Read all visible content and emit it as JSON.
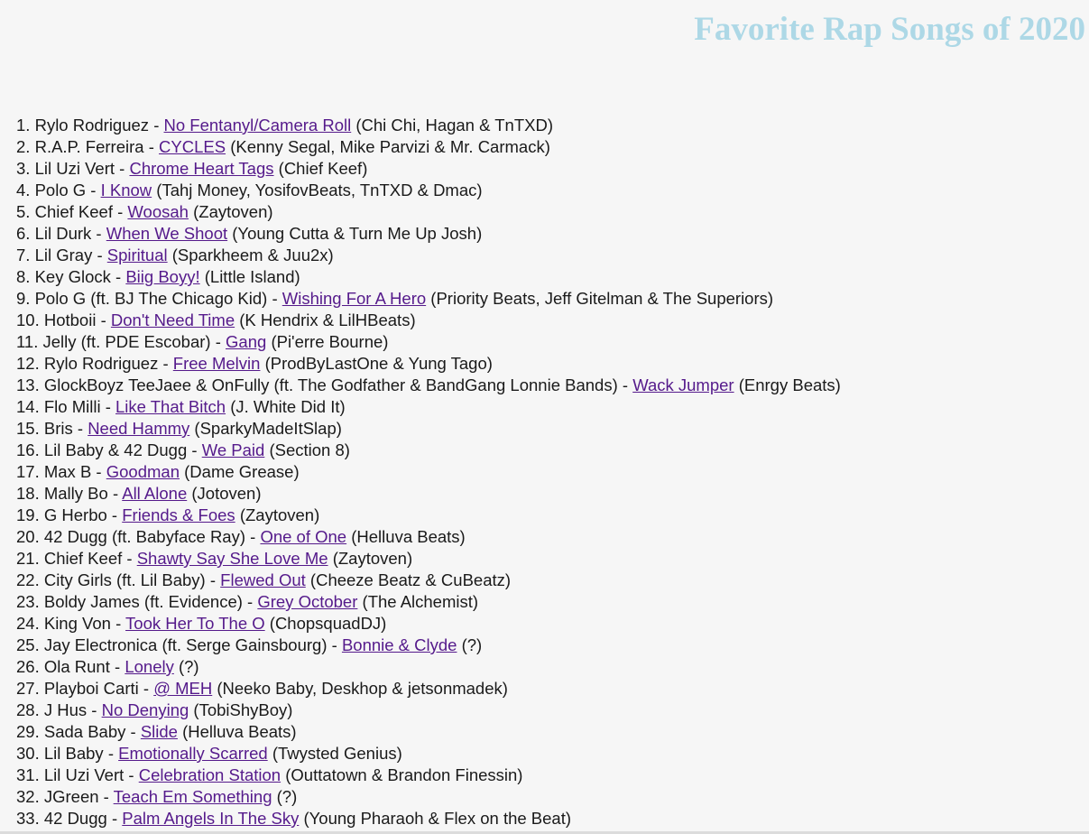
{
  "title": "Favorite Rap Songs of 2020",
  "colors": {
    "title": "#add8e6",
    "link_visited": "#551a8b",
    "text": "#1a1a1a",
    "background": "#f6f6f6"
  },
  "songs": [
    {
      "number": "1.",
      "artist": "Rylo Rodriguez",
      "title": "No Fentanyl/Camera Roll",
      "producers": "(Chi Chi, Hagan & TnTXD)"
    },
    {
      "number": "2.",
      "artist": "R.A.P. Ferreira",
      "title": "CYCLES",
      "producers": "(Kenny Segal, Mike Parvizi & Mr. Carmack)"
    },
    {
      "number": "3.",
      "artist": "Lil Uzi Vert",
      "title": "Chrome Heart Tags",
      "producers": "(Chief Keef)"
    },
    {
      "number": "4.",
      "artist": "Polo G",
      "title": "I Know",
      "producers": "(Tahj Money, YosifovBeats, TnTXD & Dmac)"
    },
    {
      "number": "5.",
      "artist": "Chief Keef",
      "title": "Woosah",
      "producers": "(Zaytoven)"
    },
    {
      "number": "6.",
      "artist": "Lil Durk",
      "title": "When We Shoot",
      "producers": "(Young Cutta & Turn Me Up Josh)"
    },
    {
      "number": "7.",
      "artist": "Lil Gray",
      "title": "Spiritual",
      "producers": "(Sparkheem & Juu2x)"
    },
    {
      "number": "8.",
      "artist": "Key Glock",
      "title": "Biig Boyy!",
      "producers": "(Little Island)"
    },
    {
      "number": "9.",
      "artist": "Polo G (ft. BJ The Chicago Kid)",
      "title": "Wishing For A Hero",
      "producers": "(Priority Beats, Jeff Gitelman & The Superiors)"
    },
    {
      "number": "10.",
      "artist": "Hotboii",
      "title": "Don't Need Time",
      "producers": "(K Hendrix & LilHBeats)"
    },
    {
      "number": "11.",
      "artist": "Jelly (ft. PDE Escobar)",
      "title": "Gang",
      "producers": "(Pi'erre Bourne)"
    },
    {
      "number": "12.",
      "artist": "Rylo Rodriguez",
      "title": "Free Melvin",
      "producers": "(ProdByLastOne & Yung Tago)"
    },
    {
      "number": "13.",
      "artist": "GlockBoyz TeeJaee & OnFully (ft. The Godfather & BandGang Lonnie Bands)",
      "title": "Wack Jumper",
      "producers": "(Enrgy Beats)"
    },
    {
      "number": "14.",
      "artist": "Flo Milli",
      "title": "Like That Bitch",
      "producers": "(J. White Did It)"
    },
    {
      "number": "15.",
      "artist": "Bris",
      "title": "Need Hammy",
      "producers": "(SparkyMadeItSlap)"
    },
    {
      "number": "16.",
      "artist": "Lil Baby & 42 Dugg",
      "title": "We Paid",
      "producers": "(Section 8)"
    },
    {
      "number": "17.",
      "artist": "Max B",
      "title": "Goodman",
      "producers": "(Dame Grease)"
    },
    {
      "number": "18.",
      "artist": "Mally Bo",
      "title": "All Alone",
      "producers": "(Jotoven)"
    },
    {
      "number": "19.",
      "artist": "G Herbo",
      "title": "Friends & Foes",
      "producers": "(Zaytoven)"
    },
    {
      "number": "20.",
      "artist": "42 Dugg (ft. Babyface Ray)",
      "title": "One of One",
      "producers": "(Helluva Beats)"
    },
    {
      "number": "21.",
      "artist": "Chief Keef",
      "title": "Shawty Say She Love Me",
      "producers": "(Zaytoven)"
    },
    {
      "number": "22.",
      "artist": "City Girls (ft. Lil Baby)",
      "title": "Flewed Out",
      "producers": "(Cheeze Beatz & CuBeatz)"
    },
    {
      "number": "23.",
      "artist": "Boldy James (ft. Evidence)",
      "title": "Grey October",
      "producers": "(The Alchemist)"
    },
    {
      "number": "24.",
      "artist": "King Von",
      "title": "Took Her To The O",
      "producers": "(ChopsquadDJ)"
    },
    {
      "number": "25.",
      "artist": "Jay Electronica (ft. Serge Gainsbourg)",
      "title": "Bonnie & Clyde",
      "producers": "(?)"
    },
    {
      "number": "26.",
      "artist": "Ola Runt",
      "title": "Lonely",
      "producers": "(?)"
    },
    {
      "number": "27.",
      "artist": "Playboi Carti",
      "title": "@ MEH",
      "producers": "(Neeko Baby, Deskhop & jetsonmadek)"
    },
    {
      "number": "28.",
      "artist": "J Hus",
      "title": "No Denying",
      "producers": "(TobiShyBoy)"
    },
    {
      "number": "29.",
      "artist": "Sada Baby",
      "title": "Slide",
      "producers": "(Helluva Beats)"
    },
    {
      "number": "30.",
      "artist": "Lil Baby",
      "title": "Emotionally Scarred",
      "producers": "(Twysted Genius)"
    },
    {
      "number": "31.",
      "artist": "Lil Uzi Vert",
      "title": "Celebration Station",
      "producers": "(Outtatown & Brandon Finessin)"
    },
    {
      "number": "32.",
      "artist": "JGreen",
      "title": "Teach Em Something",
      "producers": "(?)"
    },
    {
      "number": "33.",
      "artist": "42 Dugg",
      "title": "Palm Angels In The Sky",
      "producers": "(Young Pharaoh & Flex on the Beat)"
    }
  ]
}
